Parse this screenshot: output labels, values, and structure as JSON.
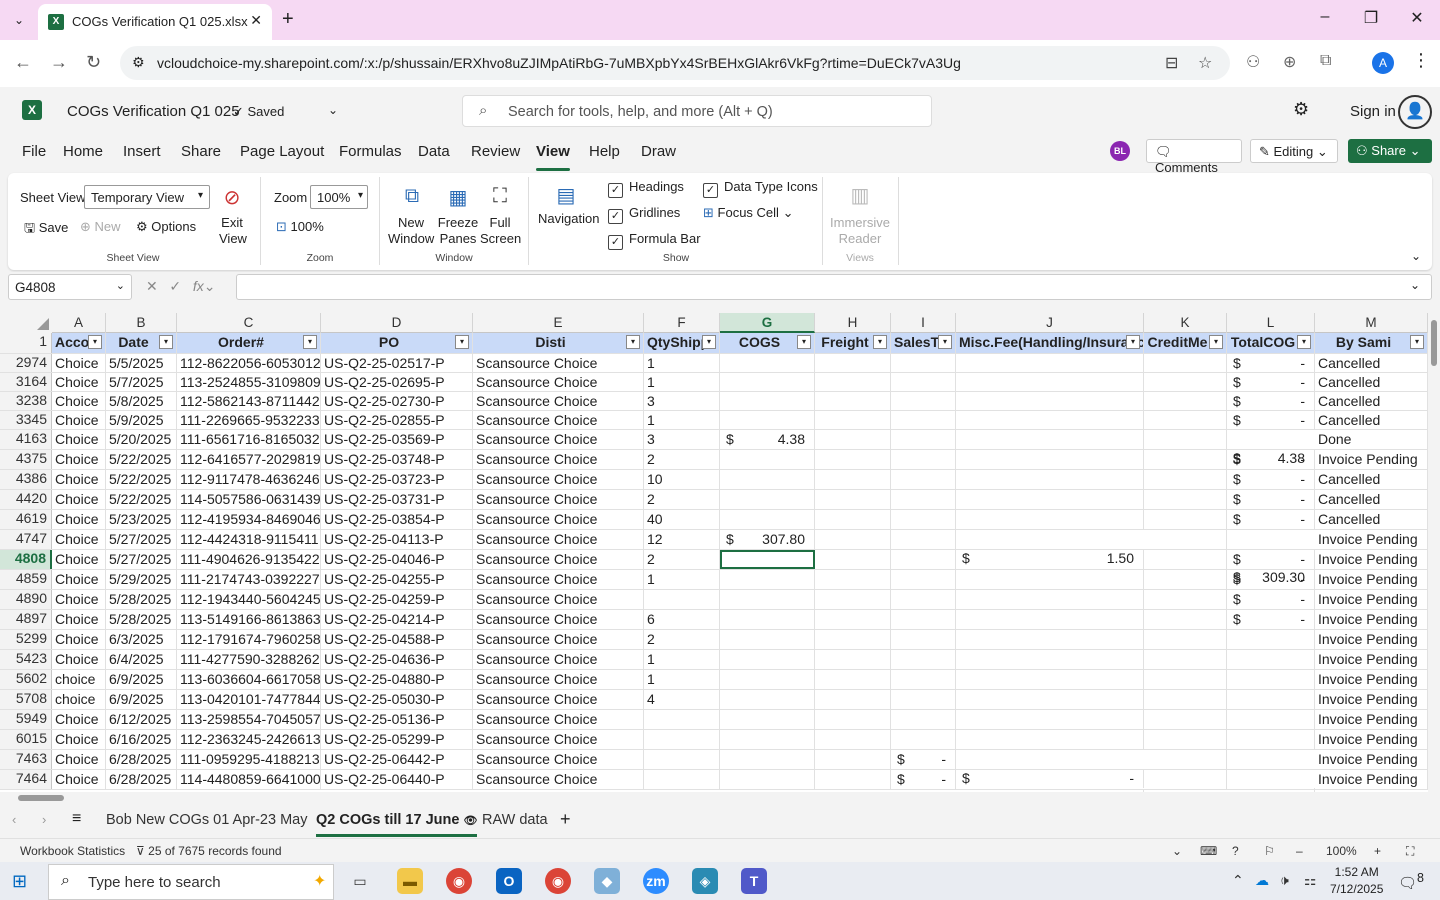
{
  "browser": {
    "tab_title": "COGs Verification Q1 025.xlsx",
    "url": "vcloudchoice-my.sharepoint.com/:x:/p/shussain/ERXhvo8uZJIMpAtiRbG-7uMBXpbYx4SrBEHxGlAkr6VkFg?rtime=DuECk7vA3Ug",
    "profile_initial": "A"
  },
  "app": {
    "file_name": "COGs Verification Q1 025",
    "save_status": "Saved",
    "search_placeholder": "Search for tools, help, and more (Alt + Q)",
    "sign_in": "Sign in"
  },
  "menu": {
    "items": [
      "File",
      "Home",
      "Insert",
      "Share",
      "Page Layout",
      "Formulas",
      "Data",
      "Review",
      "View",
      "Help",
      "Draw"
    ],
    "active": "View",
    "user_initials": "BL",
    "comments": "Comments",
    "editing": "Editing",
    "share": "Share"
  },
  "ribbon": {
    "sheet_view_label": "Sheet View",
    "sheet_view_value": "Temporary View",
    "exit_view": "Exit View",
    "save": "Save",
    "new": "New",
    "options": "Options",
    "group_sheet_view": "Sheet View",
    "zoom_label": "Zoom",
    "zoom_value": "100%",
    "zoom_100": "100%",
    "group_zoom": "Zoom",
    "new_window": "New Window",
    "freeze_panes": "Freeze Panes",
    "full_screen": "Full Screen",
    "group_window": "Window",
    "navigation": "Navigation",
    "headings": "Headings",
    "gridlines": "Gridlines",
    "formula_bar": "Formula Bar",
    "data_type_icons": "Data Type Icons",
    "focus_cell": "Focus Cell",
    "group_show": "Show",
    "immersive_reader": "Immersive Reader",
    "group_views": "Views"
  },
  "formula_bar": {
    "name_box": "G4808",
    "fx": "fx",
    "value": ""
  },
  "grid": {
    "column_letters": [
      "A",
      "B",
      "C",
      "D",
      "E",
      "F",
      "G",
      "H",
      "I",
      "J",
      "K",
      "L",
      "M"
    ],
    "selected_column": "G",
    "header_row_num": "1",
    "headers": [
      "Accou",
      "Date",
      "Order#",
      "PO",
      "Disti",
      "QtyShipp",
      "COGS",
      "Freight",
      "SalesTa",
      "Misc.Fee(Handling/Insuranc",
      "CreditMe",
      "TotalCOG",
      "By Sami"
    ],
    "selected_row": "4808",
    "rows": [
      {
        "n": "2974",
        "a": "Choice",
        "b": "5/5/2025",
        "c": "112-8622056-6053012",
        "d": "US-Q2-25-02517-P",
        "e": "Scansource Choice",
        "f": "1",
        "g": "",
        "i": "",
        "j": "",
        "l": "-",
        "m": "Cancelled"
      },
      {
        "n": "3164",
        "a": "Choice",
        "b": "5/7/2025",
        "c": "113-2524855-3109809",
        "d": "US-Q2-25-02695-P",
        "e": "Scansource Choice",
        "f": "1",
        "g": "",
        "i": "",
        "j": "",
        "l": "-",
        "m": "Cancelled"
      },
      {
        "n": "3238",
        "a": "Choice",
        "b": "5/8/2025",
        "c": "112-5862143-8711442",
        "d": "US-Q2-25-02730-P",
        "e": "Scansource Choice",
        "f": "3",
        "g": "",
        "i": "",
        "j": "",
        "l": "-",
        "m": "Cancelled"
      },
      {
        "n": "3345",
        "a": "Choice",
        "b": "5/9/2025",
        "c": "111-2269665-9532233",
        "d": "US-Q2-25-02855-P",
        "e": "Scansource Choice",
        "f": "1",
        "g": "",
        "i": "",
        "j": "",
        "l": "-",
        "m": "Cancelled"
      },
      {
        "n": "4163",
        "a": "Choice",
        "b": "5/20/2025",
        "c": "111-6561716-8165032",
        "d": "US-Q2-25-03569-P",
        "e": "Scansource Choice",
        "f": "3",
        "g": "4.38",
        "i": "",
        "j": "",
        "l": "4.38",
        "m": "Done"
      },
      {
        "n": "4375",
        "a": "Choice",
        "b": "5/22/2025",
        "c": "112-6416577-2029819",
        "d": "US-Q2-25-03748-P",
        "e": "Scansource Choice",
        "f": "2",
        "g": "",
        "i": "",
        "j": "",
        "l": "-",
        "m": "Invoice Pending"
      },
      {
        "n": "4386",
        "a": "Choice",
        "b": "5/22/2025",
        "c": "112-9117478-4636246",
        "d": "US-Q2-25-03723-P",
        "e": "Scansource Choice",
        "f": "10",
        "g": "",
        "i": "",
        "j": "",
        "l": "-",
        "m": "Cancelled"
      },
      {
        "n": "4420",
        "a": "Choice",
        "b": "5/22/2025",
        "c": "114-5057586-0631439",
        "d": "US-Q2-25-03731-P",
        "e": "Scansource Choice",
        "f": "2",
        "g": "",
        "i": "",
        "j": "",
        "l": "-",
        "m": "Cancelled"
      },
      {
        "n": "4619",
        "a": "Choice",
        "b": "5/23/2025",
        "c": "112-4195934-8469046",
        "d": "US-Q2-25-03854-P",
        "e": "Scansource Choice",
        "f": "40",
        "g": "",
        "i": "",
        "j": "",
        "l": "-",
        "m": "Cancelled"
      },
      {
        "n": "4747",
        "a": "Choice",
        "b": "5/27/2025",
        "c": "112-4424318-9115411",
        "d": "US-Q2-25-04113-P",
        "e": "Scansource Choice",
        "f": "12",
        "g": "307.80",
        "i": "",
        "j": "1.50",
        "l": "309.30",
        "m": "Invoice Pending"
      },
      {
        "n": "4808",
        "a": "Choice",
        "b": "5/27/2025",
        "c": "111-4904626-9135422",
        "d": "US-Q2-25-04046-P",
        "e": "Scansource Choice",
        "f": "2",
        "g": "",
        "i": "",
        "j": "",
        "l": "-",
        "m": "Invoice Pending"
      },
      {
        "n": "4859",
        "a": "Choice",
        "b": "5/29/2025",
        "c": "111-2174743-0392227",
        "d": "US-Q2-25-04255-P",
        "e": "Scansource Choice",
        "f": "1",
        "g": "",
        "i": "",
        "j": "",
        "l": "-",
        "m": "Invoice Pending"
      },
      {
        "n": "4890",
        "a": "Choice",
        "b": "5/28/2025",
        "c": "112-1943440-5604245",
        "d": "US-Q2-25-04259-P",
        "e": "Scansource Choice",
        "f": "",
        "g": "",
        "i": "",
        "j": "",
        "l": "-",
        "m": "Invoice Pending"
      },
      {
        "n": "4897",
        "a": "Choice",
        "b": "5/28/2025",
        "c": "113-5149166-8613863",
        "d": "US-Q2-25-04214-P",
        "e": "Scansource Choice",
        "f": "6",
        "g": "",
        "i": "",
        "j": "",
        "l": "-",
        "m": "Invoice Pending"
      },
      {
        "n": "5299",
        "a": "Choice",
        "b": "6/3/2025",
        "c": "112-1791674-7960258",
        "d": "US-Q2-25-04588-P",
        "e": "Scansource Choice",
        "f": "2",
        "g": "",
        "i": "",
        "j": "",
        "l": "",
        "m": "Invoice Pending"
      },
      {
        "n": "5423",
        "a": "Choice",
        "b": "6/4/2025",
        "c": "111-4277590-3288262",
        "d": "US-Q2-25-04636-P",
        "e": "Scansource Choice",
        "f": "1",
        "g": "",
        "i": "",
        "j": "",
        "l": "",
        "m": "Invoice Pending"
      },
      {
        "n": "5602",
        "a": "choice",
        "b": "6/9/2025",
        "c": "113-6036604-6617058",
        "d": "US-Q2-25-04880-P",
        "e": "Scansource Choice",
        "f": "1",
        "g": "",
        "i": "",
        "j": "",
        "l": "",
        "m": "Invoice Pending"
      },
      {
        "n": "5708",
        "a": "choice",
        "b": "6/9/2025",
        "c": "113-0420101-7477844",
        "d": "US-Q2-25-05030-P",
        "e": "Scansource Choice",
        "f": "4",
        "g": "",
        "i": "",
        "j": "",
        "l": "",
        "m": "Invoice Pending"
      },
      {
        "n": "5949",
        "a": "Choice",
        "b": "6/12/2025",
        "c": "113-2598554-7045057",
        "d": "US-Q2-25-05136-P",
        "e": "Scansource Choice",
        "f": "",
        "g": "",
        "i": "",
        "j": "",
        "l": "",
        "m": "Invoice Pending"
      },
      {
        "n": "6015",
        "a": "Choice",
        "b": "6/16/2025",
        "c": "112-2363245-2426613",
        "d": "US-Q2-25-05299-P",
        "e": "Scansource Choice",
        "f": "",
        "g": "",
        "i": "",
        "j": "",
        "l": "",
        "m": "Invoice Pending"
      },
      {
        "n": "7463",
        "a": "Choice",
        "b": "6/28/2025",
        "c": "111-0959295-4188213",
        "d": "US-Q2-25-06442-P",
        "e": "Scansource Choice",
        "f": "",
        "g": "",
        "i": "-",
        "j": "-",
        "l": "-",
        "m": "Invoice Pending"
      },
      {
        "n": "7464",
        "a": "Choice",
        "b": "6/28/2025",
        "c": "114-4480859-6641000",
        "d": "US-Q2-25-06440-P",
        "e": "Scansource Choice",
        "f": "",
        "g": "",
        "i": "-",
        "j": "-",
        "l": "-",
        "m": "Invoice Pending"
      }
    ]
  },
  "sheets": {
    "tabs": [
      "Bob New COGs 01 Apr-23 May",
      "Q2 COGs till 17 June",
      "RAW data"
    ],
    "active": "Q2 COGs till 17 June"
  },
  "status": {
    "workbook_stats": "Workbook Statistics",
    "records": "25 of 7675 records found",
    "zoom": "100%"
  },
  "taskbar": {
    "search_placeholder": "Type here to search",
    "time": "1:52 AM",
    "date": "7/12/2025",
    "notifications": "8"
  },
  "colors": {
    "excel_green": "#1d6f42",
    "header_fill": "#c9daf8",
    "tab_strip": "#f6d9f3"
  }
}
